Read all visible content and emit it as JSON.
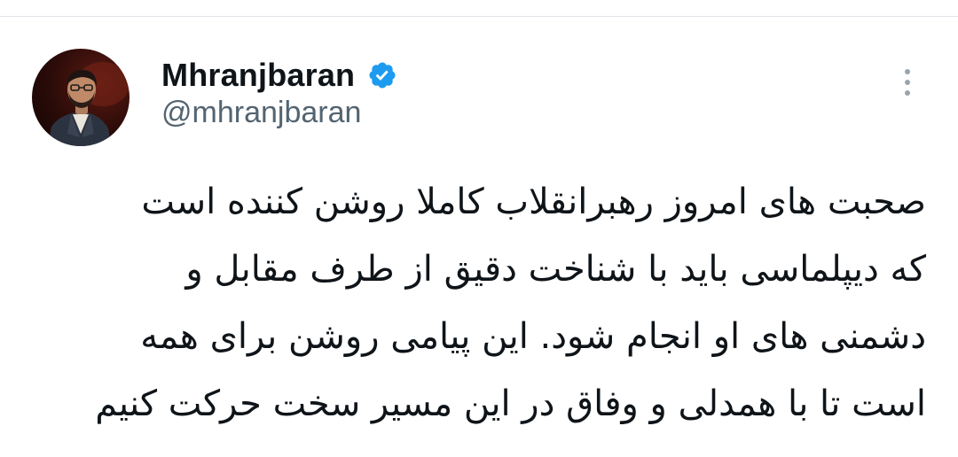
{
  "author": {
    "display_name": "Mhranjbaran",
    "handle": "@mhranjbaran",
    "verified": true,
    "verified_color": "#1d9bf0",
    "avatar_icon": "profile-photo"
  },
  "actions": {
    "more_icon": "more-vertical-icon"
  },
  "tweet": {
    "lines": [
      "صحبت های امروز رهبرانقلاب کاملا روشن کننده است",
      "که دیپلماسی باید با شناخت دقیق  از طرف مقابل و",
      "دشمنی های او انجام شود. این پیامی روشن برای همه",
      "است تا با همدلی و وفاق در این مسیر سخت حرکت کنیم"
    ]
  },
  "colors": {
    "text": "#0f1419",
    "secondary": "#536471",
    "divider": "#e1e6ea"
  }
}
